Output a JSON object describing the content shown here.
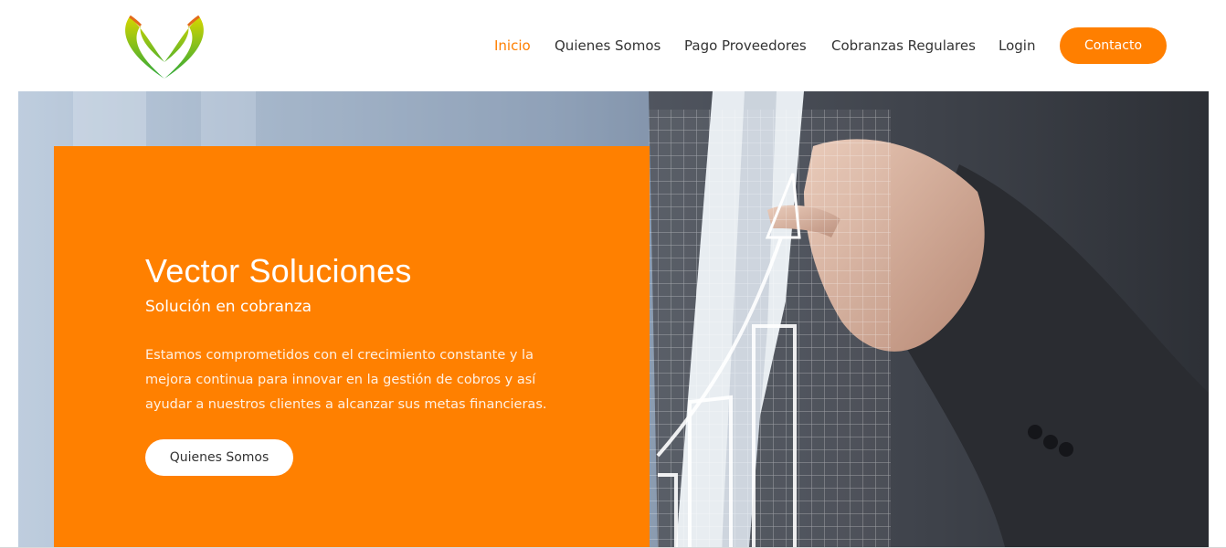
{
  "brand": {
    "logo_icon": "vector-leaf-logo-icon",
    "colors": {
      "accent": "#ff7f00",
      "logo_green": "#3db33a",
      "logo_yellow": "#c8d400"
    }
  },
  "nav": {
    "items": [
      {
        "label": "Inicio",
        "active": true
      },
      {
        "label": "Quienes Somos",
        "active": false
      },
      {
        "label": "Pago Proveedores",
        "active": false
      },
      {
        "label": "Cobranzas Regulares",
        "active": false
      },
      {
        "label": "Login",
        "active": false
      }
    ],
    "contact_label": "Contacto"
  },
  "hero": {
    "title": "Vector Soluciones",
    "subtitle": "Solución en cobranza",
    "description": "Estamos comprometidos con el crecimiento constante y la mejora continua para innovar en la gestión de cobros y así ayudar a nuestros clientes a alcanzar sus metas financieras.",
    "button_label": "Quienes Somos",
    "image_icon": "businessman-growth-chart-photo"
  }
}
